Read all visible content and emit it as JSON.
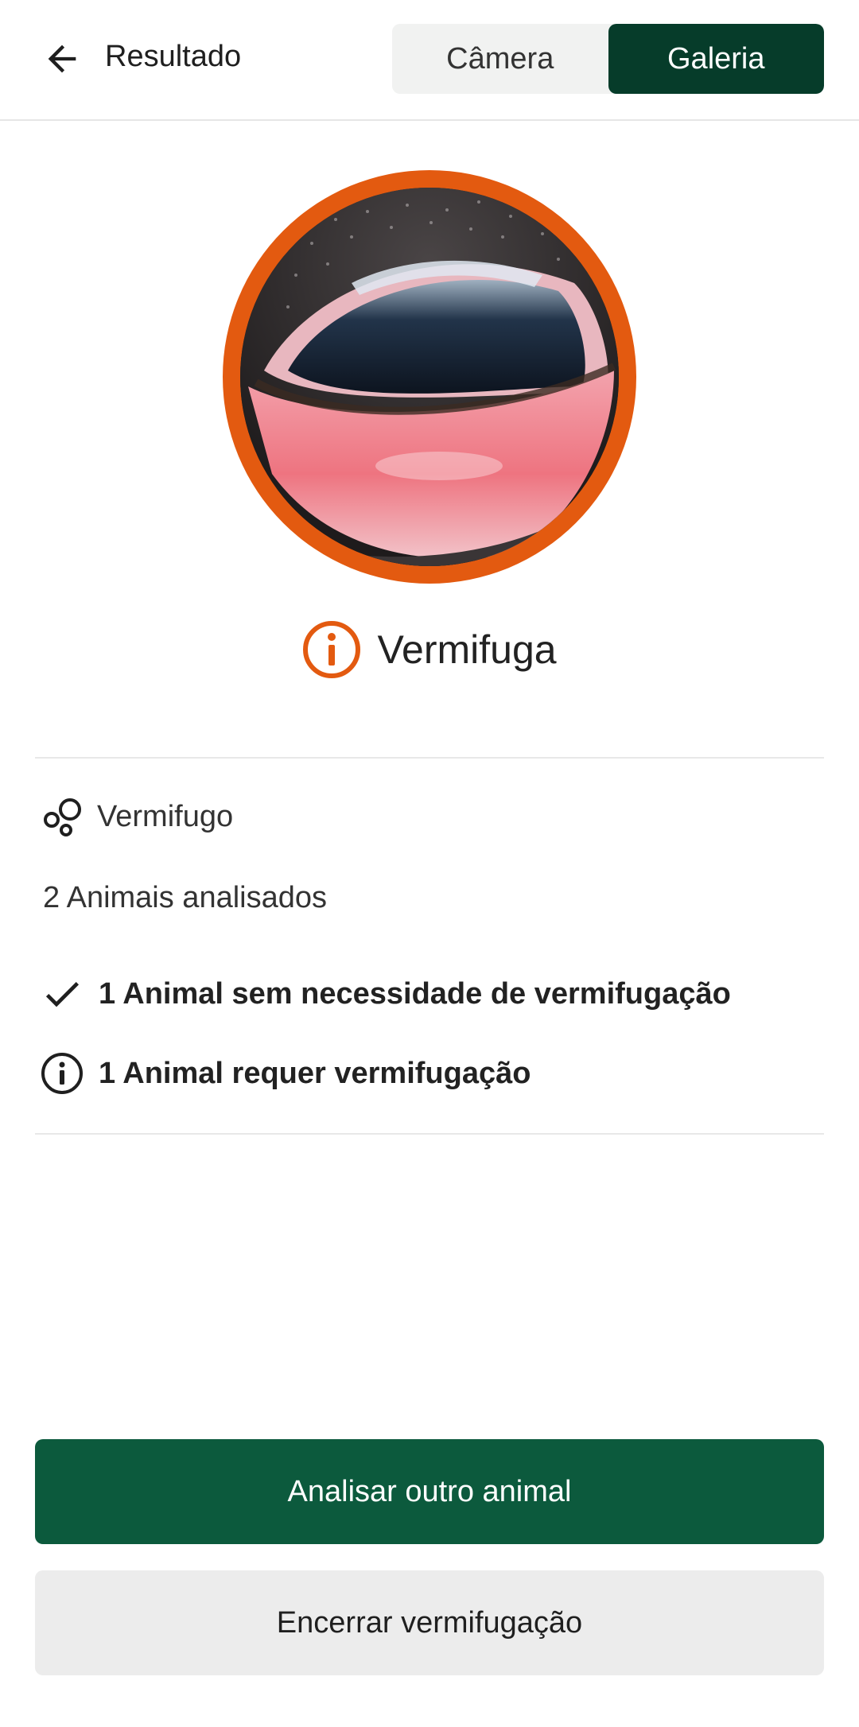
{
  "header": {
    "title": "Resultado",
    "tabs": [
      {
        "label": "Câmera"
      },
      {
        "label": "Galeria"
      }
    ],
    "active_tab": "Galeria"
  },
  "result": {
    "status_label": "Vermifuga",
    "status_icon": "info-icon",
    "accent_color": "#e35a10"
  },
  "summary": {
    "category_icon": "bubbles-icon",
    "category_label": "Vermifugo",
    "count_label": "2 Animais analisados",
    "items": [
      {
        "icon": "check-icon",
        "label": "1 Animal sem necessidade de vermifugação"
      },
      {
        "icon": "info-icon",
        "label": "1 Animal requer vermifugação"
      }
    ]
  },
  "actions": {
    "primary_label": "Analisar outro animal",
    "secondary_label": "Encerrar vermifugação"
  },
  "colors": {
    "brand_dark": "#063c2a",
    "brand_primary": "#0c5a3d",
    "accent": "#e35a10"
  }
}
